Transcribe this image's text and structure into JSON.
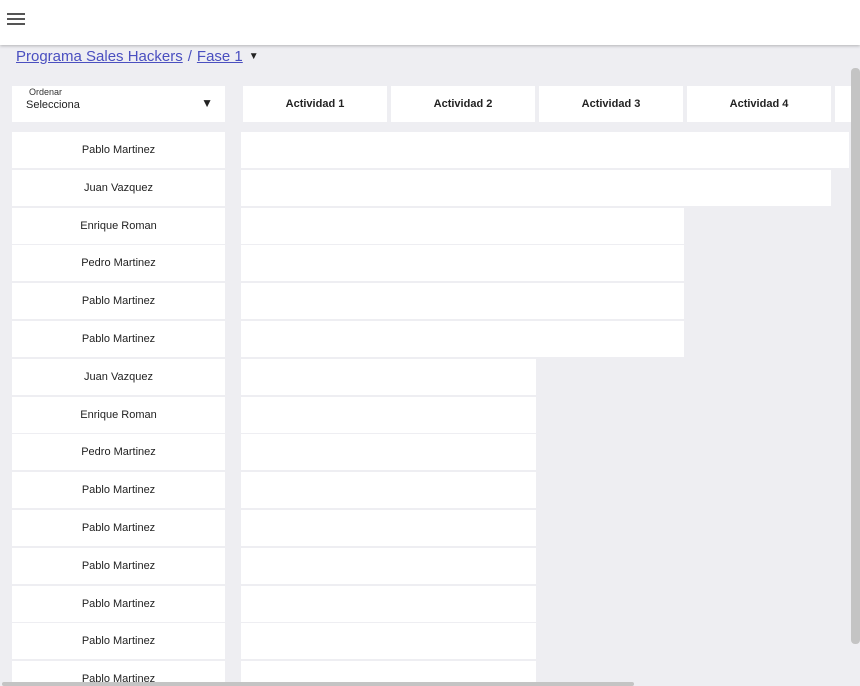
{
  "header": {
    "menu_icon": "hamburger-menu-icon"
  },
  "breadcrumb": {
    "program": "Programa Sales Hackers",
    "separator": "/",
    "phase": "Fase 1",
    "caret_icon": "caret-down-icon"
  },
  "sort": {
    "label": "Ordenar",
    "value": "Selecciona",
    "arrow": "▼"
  },
  "columns": [
    "Actividad 1",
    "Actividad 2",
    "Actividad 3",
    "Actividad 4"
  ],
  "rows": [
    {
      "name": "Pablo Martinez",
      "activities_completed": 4
    },
    {
      "name": "Juan Vazquez",
      "activities_completed": 4
    },
    {
      "name": "Enrique Roman",
      "activities_completed": 3
    },
    {
      "name": "Pedro Martinez",
      "activities_completed": 3
    },
    {
      "name": "Pablo Martinez",
      "activities_completed": 3
    },
    {
      "name": "Pablo Martinez",
      "activities_completed": 3
    },
    {
      "name": "Juan Vazquez",
      "activities_completed": 2
    },
    {
      "name": "Enrique Roman",
      "activities_completed": 2
    },
    {
      "name": "Pedro Martinez",
      "activities_completed": 2
    },
    {
      "name": "Pablo Martinez",
      "activities_completed": 2
    },
    {
      "name": "Pablo Martinez",
      "activities_completed": 2
    },
    {
      "name": "Pablo Martinez",
      "activities_completed": 2
    },
    {
      "name": "Pablo Martinez",
      "activities_completed": 2
    },
    {
      "name": "Pablo Martinez",
      "activities_completed": 2
    },
    {
      "name": "Pablo Martinez",
      "activities_completed": 2
    }
  ]
}
